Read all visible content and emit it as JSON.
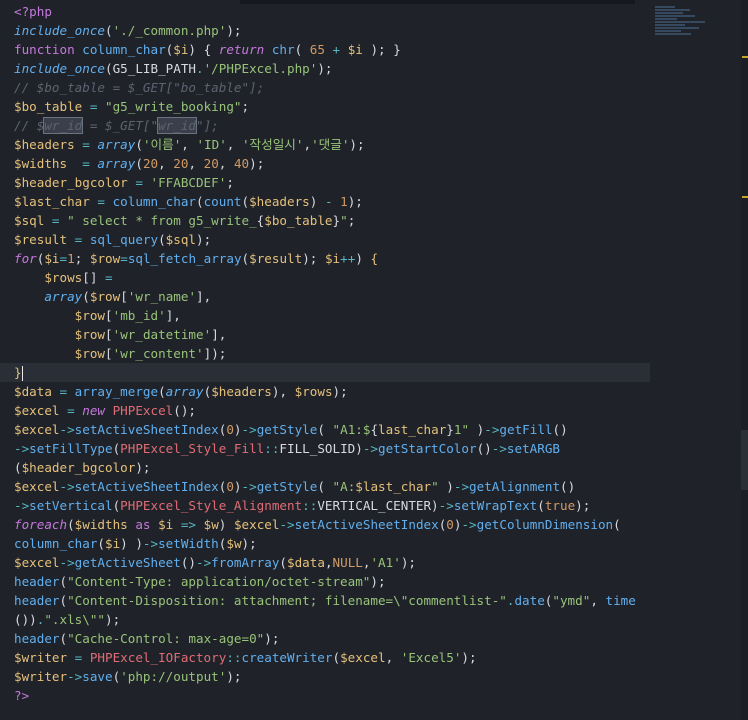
{
  "editor": {
    "language": "php",
    "lines": [
      [
        [
          "t-kw",
          "<?php"
        ]
      ],
      [
        [
          "t-fni",
          "include_once"
        ],
        [
          "t-plain",
          "("
        ],
        [
          "t-str",
          "'./_common.php'"
        ],
        [
          "t-plain",
          ");"
        ]
      ],
      [
        [
          "t-kw",
          "function "
        ],
        [
          "t-fn",
          "column_char"
        ],
        [
          "t-plain",
          "("
        ],
        [
          "t-var",
          "$i"
        ],
        [
          "t-plain",
          ") { "
        ],
        [
          "t-kwi",
          "return "
        ],
        [
          "t-fn",
          "chr"
        ],
        [
          "t-plain",
          "( "
        ],
        [
          "t-num",
          "65"
        ],
        [
          "t-op",
          " + "
        ],
        [
          "t-var",
          "$i"
        ],
        [
          "t-plain",
          " ); }"
        ]
      ],
      [
        [
          "t-fni",
          "include_once"
        ],
        [
          "t-plain",
          "("
        ],
        [
          "t-plain",
          "G5_LIB_PATH"
        ],
        [
          "t-op",
          "."
        ],
        [
          "t-str",
          "'/PHPExcel.php'"
        ],
        [
          "t-plain",
          ");"
        ]
      ],
      [
        [
          "t-cm",
          "// $bo_table = $_GET[\"bo_table\"];"
        ]
      ],
      [
        [
          "t-var",
          "$bo_table"
        ],
        [
          "t-op",
          " = "
        ],
        [
          "t-str",
          "\"g5_write_booking\""
        ],
        [
          "t-plain",
          ";"
        ]
      ],
      [
        [
          "t-cm",
          "// $"
        ],
        [
          "t-cm hl",
          "wr_id"
        ],
        [
          "t-cm",
          " = $_GET[\""
        ],
        [
          "t-cm hl",
          "wr_id"
        ],
        [
          "t-cm",
          "\"];"
        ]
      ],
      [
        [
          "t-var",
          "$headers"
        ],
        [
          "t-op",
          " = "
        ],
        [
          "t-fni",
          "array"
        ],
        [
          "t-plain",
          "("
        ],
        [
          "t-str",
          "'이름'"
        ],
        [
          "t-plain",
          ", "
        ],
        [
          "t-str",
          "'ID'"
        ],
        [
          "t-plain",
          ", "
        ],
        [
          "t-str",
          "'작성일시'"
        ],
        [
          "t-plain",
          ","
        ],
        [
          "t-str",
          "'댓글'"
        ],
        [
          "t-plain",
          ");"
        ]
      ],
      [
        [
          "t-var",
          "$widths"
        ],
        [
          "t-op",
          "  = "
        ],
        [
          "t-fni",
          "array"
        ],
        [
          "t-plain",
          "("
        ],
        [
          "t-num",
          "20"
        ],
        [
          "t-plain",
          ", "
        ],
        [
          "t-num",
          "20"
        ],
        [
          "t-plain",
          ", "
        ],
        [
          "t-num",
          "20"
        ],
        [
          "t-plain",
          ", "
        ],
        [
          "t-num",
          "40"
        ],
        [
          "t-plain",
          ");"
        ]
      ],
      [
        [
          "t-var",
          "$header_bgcolor"
        ],
        [
          "t-op",
          " = "
        ],
        [
          "t-str",
          "'FFABCDEF'"
        ],
        [
          "t-plain",
          ";"
        ]
      ],
      [
        [
          "t-var",
          "$last_char"
        ],
        [
          "t-op",
          " = "
        ],
        [
          "t-fn",
          "column_char"
        ],
        [
          "t-plain",
          "("
        ],
        [
          "t-fn",
          "count"
        ],
        [
          "t-plain",
          "("
        ],
        [
          "t-var",
          "$headers"
        ],
        [
          "t-plain",
          ")"
        ],
        [
          "t-op",
          " - "
        ],
        [
          "t-num",
          "1"
        ],
        [
          "t-plain",
          ");"
        ]
      ],
      [
        [
          "t-var",
          "$sql"
        ],
        [
          "t-op",
          " = "
        ],
        [
          "t-str",
          "\" select * from g5_write_"
        ],
        [
          "t-plain",
          "{"
        ],
        [
          "t-var",
          "$bo_table"
        ],
        [
          "t-plain",
          "}"
        ],
        [
          "t-str",
          "\""
        ],
        [
          "t-plain",
          ";"
        ]
      ],
      [
        [
          "t-var",
          "$result"
        ],
        [
          "t-op",
          " = "
        ],
        [
          "t-fn",
          "sql_query"
        ],
        [
          "t-plain",
          "("
        ],
        [
          "t-var",
          "$sql"
        ],
        [
          "t-plain",
          ");"
        ]
      ],
      [
        [
          "t-kwi",
          "for"
        ],
        [
          "t-plain",
          "("
        ],
        [
          "t-var",
          "$i"
        ],
        [
          "t-op",
          "="
        ],
        [
          "t-num",
          "1"
        ],
        [
          "t-plain",
          "; "
        ],
        [
          "t-var",
          "$row"
        ],
        [
          "t-op",
          "="
        ],
        [
          "t-fn",
          "sql_fetch_array"
        ],
        [
          "t-plain",
          "("
        ],
        [
          "t-var",
          "$result"
        ],
        [
          "t-plain",
          "); "
        ],
        [
          "t-var",
          "$i"
        ],
        [
          "t-op",
          "++"
        ],
        [
          "t-plain",
          ") "
        ],
        [
          "t-brk",
          "{"
        ]
      ],
      [
        [
          "t-plain",
          "    "
        ],
        [
          "t-var",
          "$rows"
        ],
        [
          "t-plain",
          "[]"
        ],
        [
          "t-op",
          " ="
        ]
      ],
      [
        [
          "t-plain",
          "    "
        ],
        [
          "t-fni",
          "array"
        ],
        [
          "t-plain",
          "("
        ],
        [
          "t-var",
          "$row"
        ],
        [
          "t-plain",
          "["
        ],
        [
          "t-str",
          "'wr_name'"
        ],
        [
          "t-plain",
          "],"
        ]
      ],
      [
        [
          "t-plain",
          "        "
        ],
        [
          "t-var",
          "$row"
        ],
        [
          "t-plain",
          "["
        ],
        [
          "t-str",
          "'mb_id'"
        ],
        [
          "t-plain",
          "],"
        ]
      ],
      [
        [
          "t-plain",
          "        "
        ],
        [
          "t-var",
          "$row"
        ],
        [
          "t-plain",
          "["
        ],
        [
          "t-str",
          "'wr_datetime'"
        ],
        [
          "t-plain",
          "],"
        ]
      ],
      [
        [
          "t-plain",
          "        "
        ],
        [
          "t-var",
          "$row"
        ],
        [
          "t-plain",
          "["
        ],
        [
          "t-str",
          "'wr_content'"
        ],
        [
          "t-plain",
          "]);"
        ]
      ],
      [
        [
          "t-brk",
          "}"
        ]
      ],
      [
        [
          "t-var",
          "$data"
        ],
        [
          "t-op",
          " = "
        ],
        [
          "t-fn",
          "array_merge"
        ],
        [
          "t-plain",
          "("
        ],
        [
          "t-fni",
          "array"
        ],
        [
          "t-plain",
          "("
        ],
        [
          "t-var",
          "$headers"
        ],
        [
          "t-plain",
          "), "
        ],
        [
          "t-var",
          "$rows"
        ],
        [
          "t-plain",
          ");"
        ]
      ],
      [
        [
          "t-var",
          "$excel"
        ],
        [
          "t-op",
          " = "
        ],
        [
          "t-kwi",
          "new "
        ],
        [
          "t-cls",
          "PHPExcel"
        ],
        [
          "t-plain",
          "();"
        ]
      ],
      [
        [
          "t-var",
          "$excel"
        ],
        [
          "t-op",
          "->"
        ],
        [
          "t-fn",
          "setActiveSheetIndex"
        ],
        [
          "t-plain",
          "("
        ],
        [
          "t-num",
          "0"
        ],
        [
          "t-plain",
          ")"
        ],
        [
          "t-op",
          "->"
        ],
        [
          "t-fn",
          "getStyle"
        ],
        [
          "t-plain",
          "( "
        ],
        [
          "t-str",
          "\"A1:$"
        ],
        [
          "t-plain",
          "{"
        ],
        [
          "t-var",
          "last_char"
        ],
        [
          "t-plain",
          "}"
        ],
        [
          "t-str",
          "1\""
        ],
        [
          "t-plain",
          " )"
        ],
        [
          "t-op",
          "->"
        ],
        [
          "t-fn",
          "getFill"
        ],
        [
          "t-plain",
          "()"
        ]
      ],
      [
        [
          "t-op",
          "->"
        ],
        [
          "t-fn",
          "setFillType"
        ],
        [
          "t-plain",
          "("
        ],
        [
          "t-cls",
          "PHPExcel_Style_Fill"
        ],
        [
          "t-op",
          "::"
        ],
        [
          "t-plain",
          "FILL_SOLID)"
        ],
        [
          "t-op",
          "->"
        ],
        [
          "t-fn",
          "getStartColor"
        ],
        [
          "t-plain",
          "()"
        ],
        [
          "t-op",
          "->"
        ],
        [
          "t-fn",
          "setARGB"
        ]
      ],
      [
        [
          "t-plain",
          "("
        ],
        [
          "t-var",
          "$header_bgcolor"
        ],
        [
          "t-plain",
          ");"
        ]
      ],
      [
        [
          "t-var",
          "$excel"
        ],
        [
          "t-op",
          "->"
        ],
        [
          "t-fn",
          "setActiveSheetIndex"
        ],
        [
          "t-plain",
          "("
        ],
        [
          "t-num",
          "0"
        ],
        [
          "t-plain",
          ")"
        ],
        [
          "t-op",
          "->"
        ],
        [
          "t-fn",
          "getStyle"
        ],
        [
          "t-plain",
          "( "
        ],
        [
          "t-str",
          "\"A:"
        ],
        [
          "t-var",
          "$last_char"
        ],
        [
          "t-str",
          "\""
        ],
        [
          "t-plain",
          " )"
        ],
        [
          "t-op",
          "->"
        ],
        [
          "t-fn",
          "getAlignment"
        ],
        [
          "t-plain",
          "()"
        ]
      ],
      [
        [
          "t-op",
          "->"
        ],
        [
          "t-fn",
          "setVertical"
        ],
        [
          "t-plain",
          "("
        ],
        [
          "t-cls",
          "PHPExcel_Style_Alignment"
        ],
        [
          "t-op",
          "::"
        ],
        [
          "t-plain",
          "VERTICAL_CENTER)"
        ],
        [
          "t-op",
          "->"
        ],
        [
          "t-fn",
          "setWrapText"
        ],
        [
          "t-plain",
          "("
        ],
        [
          "t-num",
          "true"
        ],
        [
          "t-plain",
          ");"
        ]
      ],
      [
        [
          "t-kwi",
          "foreach"
        ],
        [
          "t-plain",
          "("
        ],
        [
          "t-var",
          "$widths"
        ],
        [
          "t-kw",
          " as "
        ],
        [
          "t-var",
          "$i"
        ],
        [
          "t-op",
          " => "
        ],
        [
          "t-var",
          "$w"
        ],
        [
          "t-plain",
          ") "
        ],
        [
          "t-var",
          "$excel"
        ],
        [
          "t-op",
          "->"
        ],
        [
          "t-fn",
          "setActiveSheetIndex"
        ],
        [
          "t-plain",
          "("
        ],
        [
          "t-num",
          "0"
        ],
        [
          "t-plain",
          ")"
        ],
        [
          "t-op",
          "->"
        ],
        [
          "t-fn",
          "getColumnDimension"
        ],
        [
          "t-plain",
          "("
        ]
      ],
      [
        [
          "t-fn",
          "column_char"
        ],
        [
          "t-plain",
          "("
        ],
        [
          "t-var",
          "$i"
        ],
        [
          "t-plain",
          ") )"
        ],
        [
          "t-op",
          "->"
        ],
        [
          "t-fn",
          "setWidth"
        ],
        [
          "t-plain",
          "("
        ],
        [
          "t-var",
          "$w"
        ],
        [
          "t-plain",
          ");"
        ]
      ],
      [
        [
          "t-var",
          "$excel"
        ],
        [
          "t-op",
          "->"
        ],
        [
          "t-fn",
          "getActiveSheet"
        ],
        [
          "t-plain",
          "()"
        ],
        [
          "t-op",
          "->"
        ],
        [
          "t-fn",
          "fromArray"
        ],
        [
          "t-plain",
          "("
        ],
        [
          "t-var",
          "$data"
        ],
        [
          "t-plain",
          ","
        ],
        [
          "t-num",
          "NULL"
        ],
        [
          "t-plain",
          ","
        ],
        [
          "t-str",
          "'A1'"
        ],
        [
          "t-plain",
          ");"
        ]
      ],
      [
        [
          "t-fn",
          "header"
        ],
        [
          "t-plain",
          "("
        ],
        [
          "t-str",
          "\"Content-Type: application/octet-stream\""
        ],
        [
          "t-plain",
          ");"
        ]
      ],
      [
        [
          "t-fn",
          "header"
        ],
        [
          "t-plain",
          "("
        ],
        [
          "t-str",
          "\"Content-Disposition: attachment; filename=\\\"commentlist-\""
        ],
        [
          "t-op",
          "."
        ],
        [
          "t-fn",
          "date"
        ],
        [
          "t-plain",
          "("
        ],
        [
          "t-str",
          "\"ymd\""
        ],
        [
          "t-plain",
          ", "
        ],
        [
          "t-fn",
          "time"
        ]
      ],
      [
        [
          "t-plain",
          "())"
        ],
        [
          "t-op",
          "."
        ],
        [
          "t-str",
          "\".xls\\\"\""
        ],
        [
          "t-plain",
          ");"
        ]
      ],
      [
        [
          "t-fn",
          "header"
        ],
        [
          "t-plain",
          "("
        ],
        [
          "t-str",
          "\"Cache-Control: max-age=0\""
        ],
        [
          "t-plain",
          ");"
        ]
      ],
      [
        [
          "t-var",
          "$writer"
        ],
        [
          "t-op",
          " = "
        ],
        [
          "t-cls",
          "PHPExcel_IOFactory"
        ],
        [
          "t-op",
          "::"
        ],
        [
          "t-fn",
          "createWriter"
        ],
        [
          "t-plain",
          "("
        ],
        [
          "t-var",
          "$excel"
        ],
        [
          "t-plain",
          ", "
        ],
        [
          "t-str",
          "'Excel5'"
        ],
        [
          "t-plain",
          ");"
        ]
      ],
      [
        [
          "t-var",
          "$writer"
        ],
        [
          "t-op",
          "->"
        ],
        [
          "t-fn",
          "save"
        ],
        [
          "t-plain",
          "("
        ],
        [
          "t-str",
          "'php://output'"
        ],
        [
          "t-plain",
          ");"
        ]
      ],
      [
        [
          "t-kw",
          "?>"
        ]
      ]
    ]
  }
}
